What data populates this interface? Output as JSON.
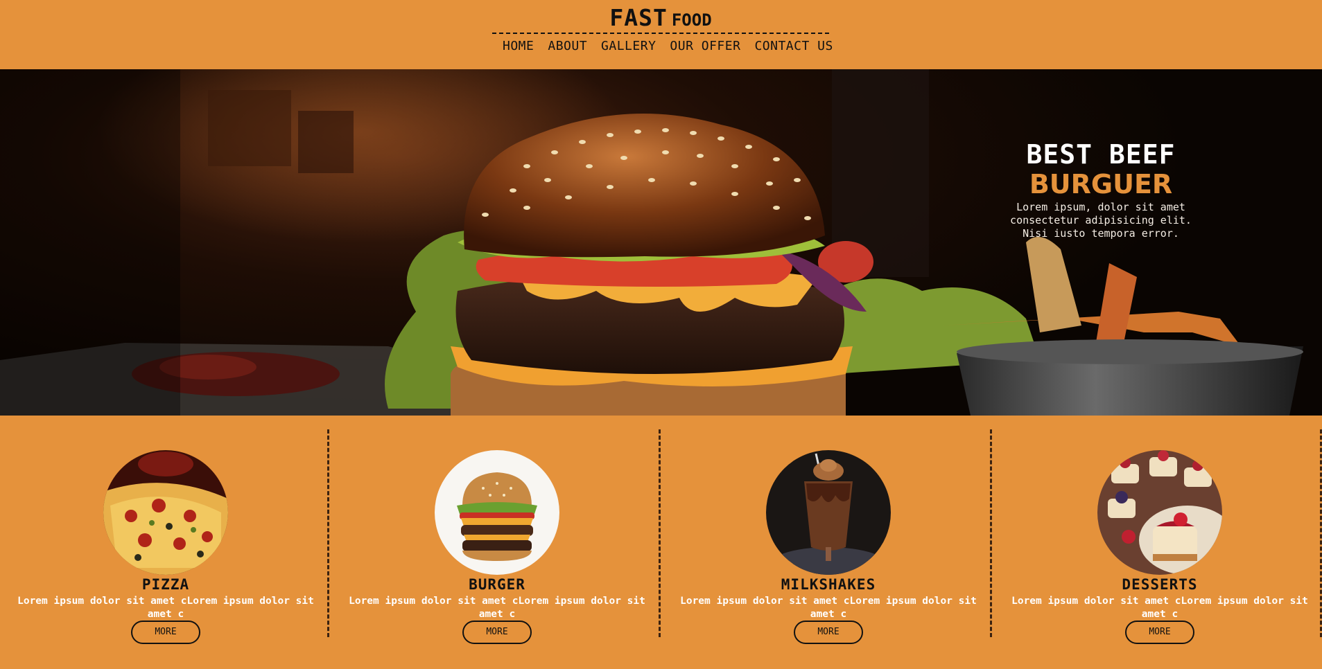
{
  "header": {
    "brand_big": "FAST",
    "brand_small": "FOOD",
    "nav": [
      "HOME",
      "ABOUT",
      "GALLERY",
      "OUR OFFER",
      "CONTACT US"
    ]
  },
  "hero": {
    "title": "BEST BEEF",
    "subtitle": "BURGUER",
    "description": "Lorem ipsum, dolor sit amet consectetur adipisicing elit. Nisi iusto tempora error."
  },
  "cards": [
    {
      "title": "PIZZA",
      "description": "Lorem ipsum dolor sit amet cLorem ipsum dolor sit amet c",
      "button": "MORE"
    },
    {
      "title": "BURGER",
      "description": "Lorem ipsum dolor sit amet cLorem ipsum dolor sit amet c",
      "button": "MORE"
    },
    {
      "title": "MILKSHAKES",
      "description": "Lorem ipsum dolor sit amet cLorem ipsum dolor sit amet c",
      "button": "MORE"
    },
    {
      "title": "DESSERTS",
      "description": "Lorem ipsum dolor sit amet cLorem ipsum dolor sit amet c",
      "button": "MORE"
    }
  ],
  "colors": {
    "accent": "#E5923B",
    "dark": "#111111",
    "hero_bg": "#0a0502"
  },
  "icons": [
    "hero-burger-image",
    "pizza-image",
    "burger-image",
    "milkshake-image",
    "desserts-image"
  ]
}
